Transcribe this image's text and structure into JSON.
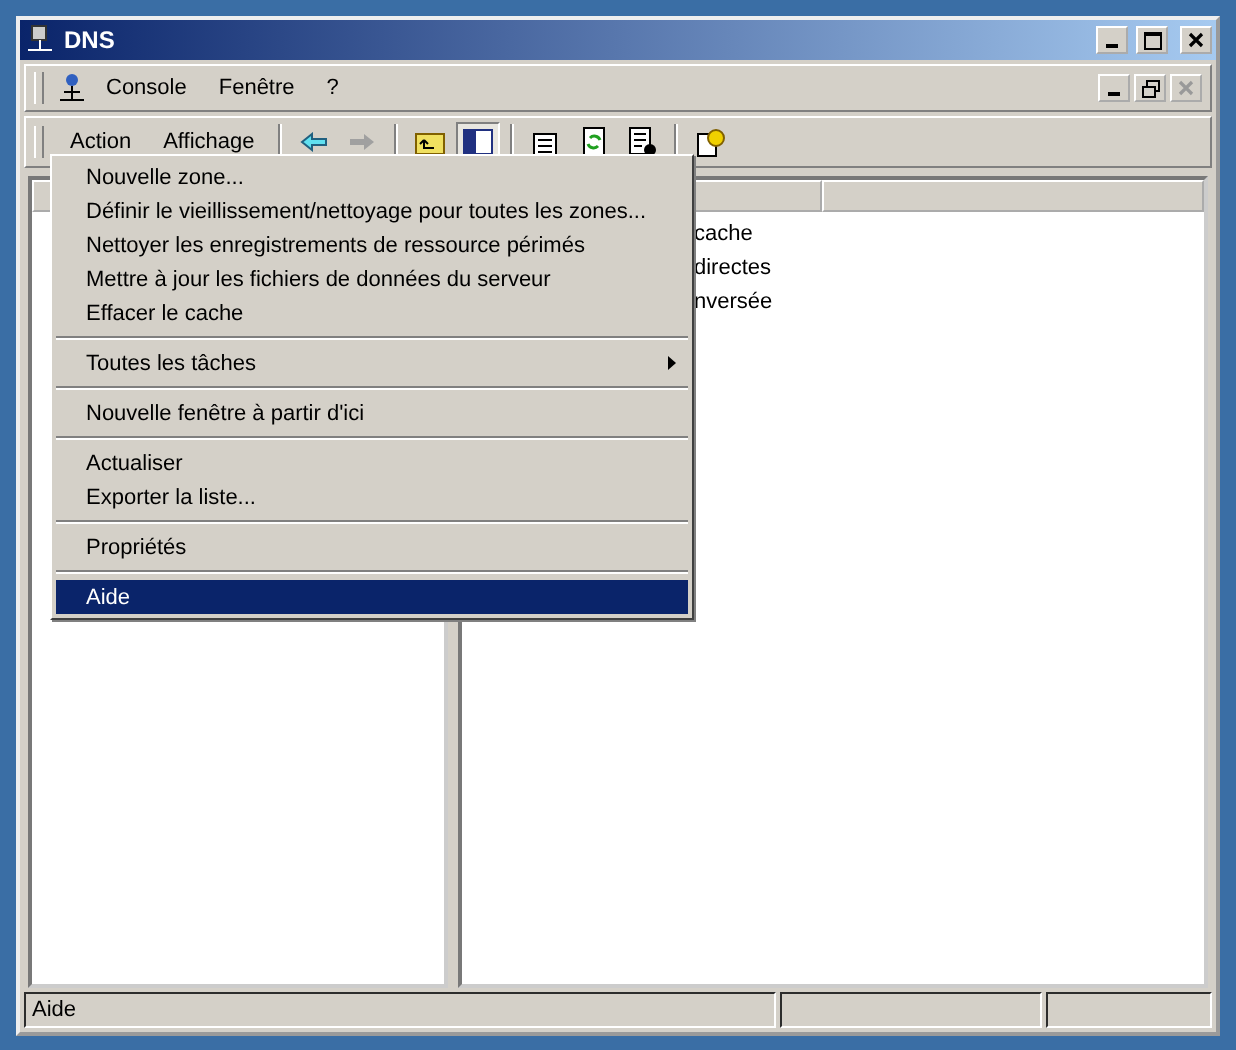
{
  "window": {
    "title": "DNS"
  },
  "menu_bar": [
    "Console",
    "Fenêtre",
    "?"
  ],
  "action_bar": [
    "Action",
    "Affichage"
  ],
  "right_pane": {
    "rows": [
      "cache",
      "directes",
      "nversée"
    ]
  },
  "context_menu": [
    {
      "kind": "item",
      "label": "Nouvelle zone...",
      "selected": false
    },
    {
      "kind": "item",
      "label": "Définir le vieillissement/nettoyage pour toutes les zones...",
      "selected": false
    },
    {
      "kind": "item",
      "label": "Nettoyer les enregistrements de ressource périmés",
      "selected": false
    },
    {
      "kind": "item",
      "label": "Mettre à jour les fichiers de données du serveur",
      "selected": false
    },
    {
      "kind": "item",
      "label": "Effacer le cache",
      "selected": false
    },
    {
      "kind": "separator"
    },
    {
      "kind": "submenu",
      "label": "Toutes les tâches",
      "selected": false
    },
    {
      "kind": "separator"
    },
    {
      "kind": "item",
      "label": "Nouvelle fenêtre à partir d'ici",
      "selected": false
    },
    {
      "kind": "separator"
    },
    {
      "kind": "item",
      "label": "Actualiser",
      "selected": false
    },
    {
      "kind": "item",
      "label": "Exporter la liste...",
      "selected": false
    },
    {
      "kind": "separator"
    },
    {
      "kind": "item",
      "label": "Propriétés",
      "selected": false
    },
    {
      "kind": "separator"
    },
    {
      "kind": "item",
      "label": "Aide",
      "selected": true
    }
  ],
  "status_bar": [
    "Aide"
  ]
}
